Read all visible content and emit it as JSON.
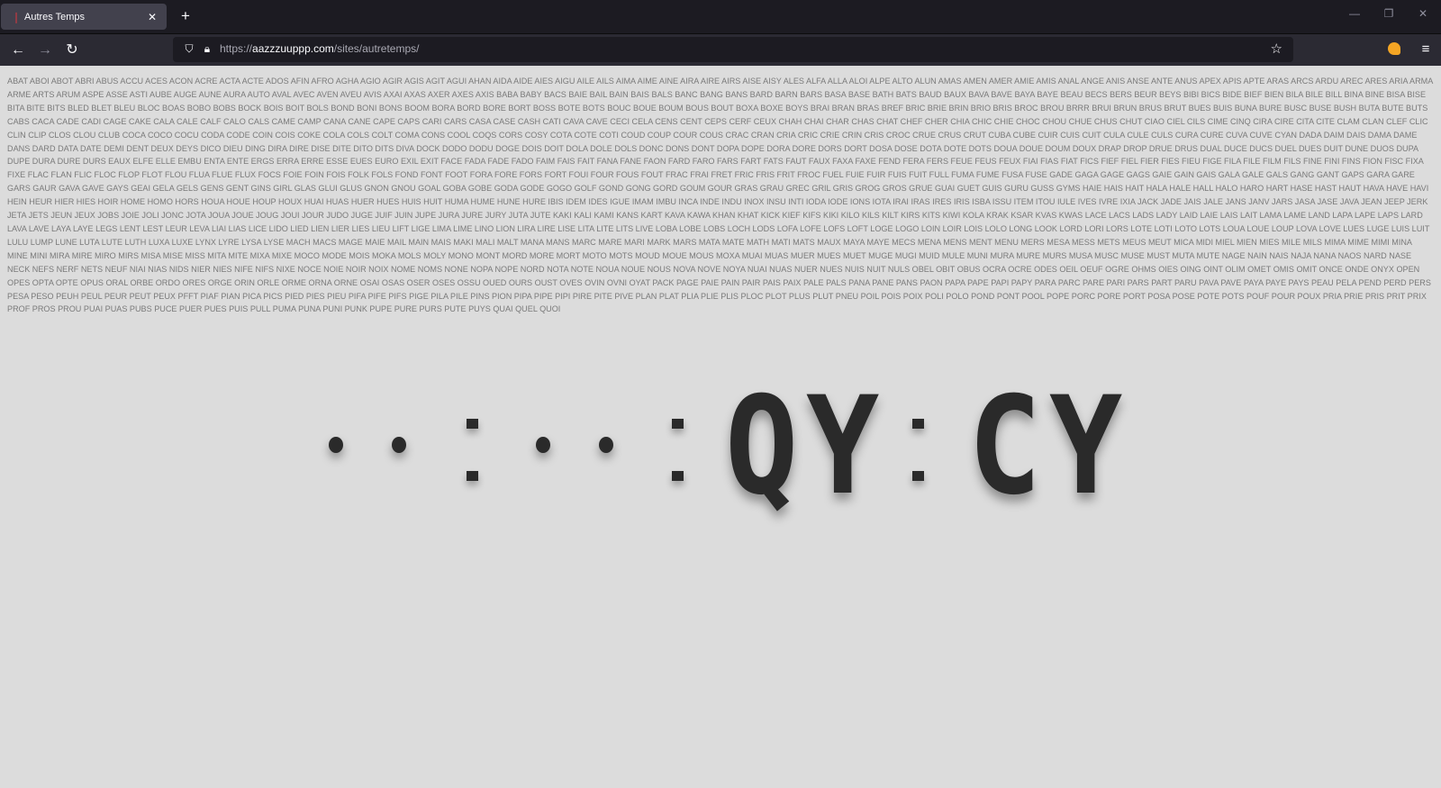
{
  "browser": {
    "tab_title": "Autres Temps",
    "tab_close": "✕",
    "new_tab": "+",
    "url_prefix": "https://",
    "url_host": "aazzzuuppp.com",
    "url_path": "/sites/autretemps/",
    "window_controls": [
      "—",
      "❐",
      "✕"
    ]
  },
  "words_text": "ABAT ABOI ABOT ABRI ABUS ACCU ACES ACON ACRE ACTA ACTE ADOS AFIN AFRO AGHA AGIO AGIR AGIS AGIT AGUI AHAN AIDA AIDE AIES AIGU AILE AILS AIMA AIME AINE AIRA AIRE AIRS AISE AISY ALES ALFA ALLA ALOI ALPE ALTO ALUN AMAS AMEN AMER AMIE AMIS ANAL ANGE ANIS ANSE ANTE ANUS APEX APIS APTE ARAS ARCS ARDU AREC ARES ARIA ARMA ARME ARTS ARUM ASPE ASSE ASTI AUBE AUGE AUNE AURA AUTO AVAL AVEC AVEN AVEU AVIS AXAI AXAS AXER AXES AXIS BABA BABY BACS BAIE BAIL BAIN BAIS BALS BANC BANG BANS BARD BARN BARS BASA BASE BATH BATS BAUD BAUX BAVA BAVE BAYA BAYE BEAU BECS BERS BEUR BEYS BIBI BICS BIDE BIEF BIEN BILA BILE BILL BINA BINE BISA BISE BITA BITE BITS BLED BLET BLEU BLOC BOAS BOBO BOBS BOCK BOIS BOIT BOLS BOND BONI BONS BOOM BORA BORD BORE BORT BOSS BOTE BOTS BOUC BOUE BOUM BOUS BOUT BOXA BOXE BOYS BRAI BRAN BRAS BREF BRIC BRIE BRIN BRIO BRIS BROC BROU BRRR BRUI BRUN BRUS BRUT BUES BUIS BUNA BURE BUSC BUSE BUSH BUTA BUTE BUTS CABS CACA CADE CADI CAGE CAKE CALA CALE CALF CALO CALS CAME CAMP CANA CANE CAPE CAPS CARI CARS CASA CASE CASH CATI CAVA CAVE CECI CELA CENS CENT CEPS CERF CEUX CHAH CHAI CHAR CHAS CHAT CHEF CHER CHIA CHIC CHIE CHOC CHOU CHUE CHUS CHUT CIAO CIEL CILS CIME CINQ CIRA CIRE CITA CITE CLAM CLAN CLEF CLIC CLIN CLIP CLOS CLOU CLUB COCA COCO COCU CODA CODE COIN COIS COKE COLA COLS COLT COMA CONS COOL COQS CORS COSY COTA COTE COTI COUD COUP COUR COUS CRAC CRAN CRIA CRIC CRIE CRIN CRIS CROC CRUE CRUS CRUT CUBA CUBE CUIR CUIS CUIT CULA CULE CULS CURA CURE CUVA CUVE CYAN DADA DAIM DAIS DAMA DAME DANS DARD DATA DATE DEMI DENT DEUX DEYS DICO DIEU DING DIRA DIRE DISE DITE DITO DITS DIVA DOCK DODO DODU DOGE DOIS DOIT DOLA DOLE DOLS DONC DONS DONT DOPA DOPE DORA DORE DORS DORT DOSA DOSE DOTA DOTE DOTS DOUA DOUE DOUM DOUX DRAP DROP DRUE DRUS DUAL DUCE DUCS DUEL DUES DUIT DUNE DUOS DUPA DUPE DURA DURE DURS EAUX ELFE ELLE EMBU ENTA ENTE ERGS ERRA ERRE ESSE EUES EURO EXIL EXIT FACE FADA FADE FADO FAIM FAIS FAIT FANA FANE FAON FARD FARO FARS FART FATS FAUT FAUX FAXA FAXE FEND FERA FERS FEUE FEUS FEUX FIAI FIAS FIAT FICS FIEF FIEL FIER FIES FIEU FIGE FILA FILE FILM FILS FINE FINI FINS FION FISC FIXA FIXE FLAC FLAN FLIC FLOC FLOP FLOT FLOU FLUA FLUE FLUX FOCS FOIE FOIN FOIS FOLK FOLS FOND FONT FOOT FORA FORE FORS FORT FOUI FOUR FOUS FOUT FRAC FRAI FRET FRIC FRIS FRIT FROC FUEL FUIE FUIR FUIS FUIT FULL FUMA FUME FUSA FUSE GADE GAGA GAGE GAGS GAIE GAIN GAIS GALA GALE GALS GANG GANT GAPS GARA GARE GARS GAUR GAVA GAVE GAYS GEAI GELA GELS GENS GENT GINS GIRL GLAS GLUI GLUS GNON GNOU GOAL GOBA GOBE GODA GODE GOGO GOLF GOND GONG GORD GOUM GOUR GRAS GRAU GREC GRIL GRIS GROG GROS GRUE GUAI GUET GUIS GURU GUSS GYMS HAIE HAIS HAIT HALA HALE HALL HALO HARO HART HASE HAST HAUT HAVA HAVE HAVI HEIN HEUR HIER HIES HOIR HOME HOMO HORS HOUA HOUE HOUP HOUX HUAI HUAS HUER HUES HUIS HUIT HUMA HUME HUNE HURE IBIS IDEM IDES IGUE IMAM IMBU INCA INDE INDU INOX INSU INTI IODA IODE IONS IOTA IRAI IRAS IRES IRIS ISBA ISSU ITEM ITOU IULE IVES IVRE IXIA JACK JADE JAIS JALE JANS JANV JARS JASA JASE JAVA JEAN JEEP JERK JETA JETS JEUN JEUX JOBS JOIE JOLI JONC JOTA JOUA JOUE JOUG JOUI JOUR JUDO JUGE JUIF JUIN JUPE JURA JURE JURY JUTA JUTE KAKI KALI KAMI KANS KART KAVA KAWA KHAN KHAT KICK KIEF KIFS KIKI KILO KILS KILT KIRS KITS KIWI KOLA KRAK KSAR KVAS KWAS LACE LACS LADS LADY LAID LAIE LAIS LAIT LAMA LAME LAND LAPA LAPE LAPS LARD LAVA LAVE LAYA LAYE LEGS LENT LEST LEUR LEVA LIAI LIAS LICE LIDO LIED LIEN LIER LIES LIEU LIFT LIGE LIMA LIME LINO LION LIRA LIRE LISE LITA LITE LITS LIVE LOBA LOBE LOBS LOCH LODS LOFA LOFE LOFS LOFT LOGE LOGO LOIN LOIR LOIS LOLO LONG LOOK LORD LORI LORS LOTE LOTI LOTO LOTS LOUA LOUE LOUP LOVA LOVE LUES LUGE LUIS LUIT LULU LUMP LUNE LUTA LUTE LUTH LUXA LUXE LYNX LYRE LYSA LYSE MACH MACS MAGE MAIE MAIL MAIN MAIS MAKI MALI MALT MANA MANS MARC MARE MARI MARK MARS MATA MATE MATH MATI MATS MAUX MAYA MAYE MECS MENA MENS MENT MENU MERS MESA MESS METS MEUS MEUT MICA MIDI MIEL MIEN MIES MILE MILS MIMA MIME MIMI MINA MINE MINI MIRA MIRE MIRO MIRS MISA MISE MISS MITA MITE MIXA MIXE MOCO MODE MOIS MOKA MOLS MOLY MONO MONT MORD MORE MORT MOTO MOTS MOUD MOUE MOUS MOXA MUAI MUAS MUER MUES MUET MUGE MUGI MUID MULE MUNI MURA MURE MURS MUSA MUSC MUSE MUST MUTA MUTE NAGE NAIN NAIS NAJA NANA NAOS NARD NASE NECK NEFS NERF NETS NEUF NIAI NIAS NIDS NIER NIES NIFE NIFS NIXE NOCE NOIE NOIR NOIX NOME NOMS NONE NOPA NOPE NORD NOTA NOTE NOUA NOUE NOUS NOVA NOVE NOYA NUAI NUAS NUER NUES NUIS NUIT NULS OBEL OBIT OBUS OCRA OCRE ODES OEIL OEUF OGRE OHMS OIES OING OINT OLIM OMET OMIS OMIT ONCE ONDE ONYX OPEN OPES OPTA OPTE OPUS ORAL ORBE ORDO ORES ORGE ORIN ORLE ORME ORNA ORNE OSAI OSAS OSER OSES OSSU OUED OURS OUST OVES OVIN OVNI OYAT PACK PAGE PAIE PAIN PAIR PAIS PAIX PALE PALS PANA PANE PANS PAON PAPA PAPE PAPI PAPY PARA PARC PARE PARI PARS PART PARU PAVA PAVE PAYA PAYE PAYS PEAU PELA PEND PERD PERS PESA PESO PEUH PEUL PEUR PEUT PEUX PFFT PIAF PIAN PICA PICS PIED PIES PIEU PIFA PIFE PIFS PIGE PILA PILE PINS PION PIPA PIPE PIPI PIRE PITE PIVE PLAN PLAT PLIA PLIE PLIS PLOC PLOT PLUS PLUT PNEU POIL POIS POIX POLI POLO POND PONT POOL POPE PORC PORE PORT POSA POSE POTE POTS POUF POUR POUX PRIA PRIE PRIS PRIT PRIX PROF PROS PROU PUAI PUAS PUBS PUCE PUER PUES PUIS PULL PUMA PUNA PUNI PUNK PUPE PURE PURS PUTE PUYS QUAI QUEL QUOI",
  "clock": {
    "colon": ":",
    "digit_1": "Q",
    "digit_2": "Y",
    "digit_3": "C",
    "digit_4": "Y"
  }
}
